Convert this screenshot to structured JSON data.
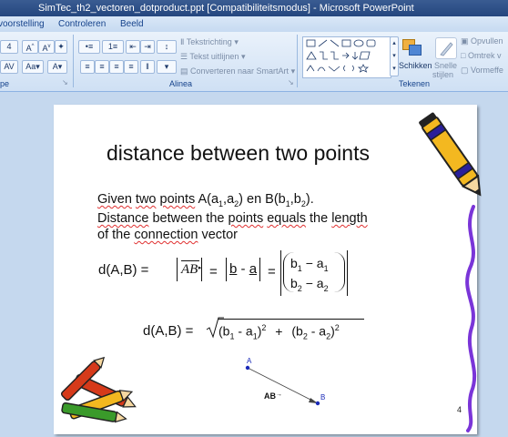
{
  "window": {
    "title": "SimTec_th2_vectoren_dotproduct.ppt [Compatibiliteitsmodus] - Microsoft PowerPoint"
  },
  "ribbon": {
    "tabs": [
      "voorstelling",
      "Controleren",
      "Beeld"
    ],
    "paragraph": {
      "label": "Alinea",
      "text_direction": "Tekstrichting",
      "align_text": "Tekst uitlijnen",
      "smartart": "Converteren naar SmartArt"
    },
    "font": {
      "size_value": "4",
      "label": "pe"
    },
    "drawing": {
      "label": "Tekenen",
      "arrange": "Schikken",
      "quick_styles_line1": "Snelle",
      "quick_styles_line2": "stijlen",
      "fill": "Opvullen",
      "outline": "Omtrek v",
      "effects": "Vormeffe"
    }
  },
  "slide": {
    "title": "distance between two points",
    "body_line1": {
      "given": "Given",
      "two": "two",
      "points": "points",
      "a_part": " A(a",
      "a_sub1": "1",
      "a_comma": ",a",
      "a_sub2": "2",
      "a_close": ") en B(b",
      "b_sub1": "1",
      "b_comma": ",b",
      "b_sub2": "2",
      "b_close": ")."
    },
    "body_line2": {
      "distance": "Distance",
      "between": " between the ",
      "points": "points",
      "equals": "equals",
      "the": " the ",
      "length": "length"
    },
    "body_line3": {
      "of_the": "of the ",
      "connection": "connection",
      "vector": " vector"
    },
    "formula1": {
      "lhs": "d(A,B) =",
      "vec": "AB",
      "eq1": "=",
      "b": "b",
      "minus": "-",
      "a": "a",
      "eq2": "=",
      "row1_b": "b",
      "row1_b_sub": "1",
      "row1_op": " − a",
      "row1_a_sub": "1",
      "row2_b": "b",
      "row2_b_sub": "2",
      "row2_op": " − a",
      "row2_a_sub": "2"
    },
    "formula2": {
      "lhs": "d(A,B) =",
      "t1": "(b",
      "t1_sub": "1",
      "t1_mid": " - a",
      "t1_sub2": "1",
      "t1_end": ")",
      "t1_exp": "2",
      "plus": "+",
      "t2": "(b",
      "t2_sub": "2",
      "t2_mid": " -  a",
      "t2_sub2": "2",
      "t2_end": ")",
      "t2_exp": "2"
    },
    "diagram": {
      "point_a": "A",
      "point_b": "B",
      "vector_label": "AB"
    },
    "page_number": "4"
  }
}
